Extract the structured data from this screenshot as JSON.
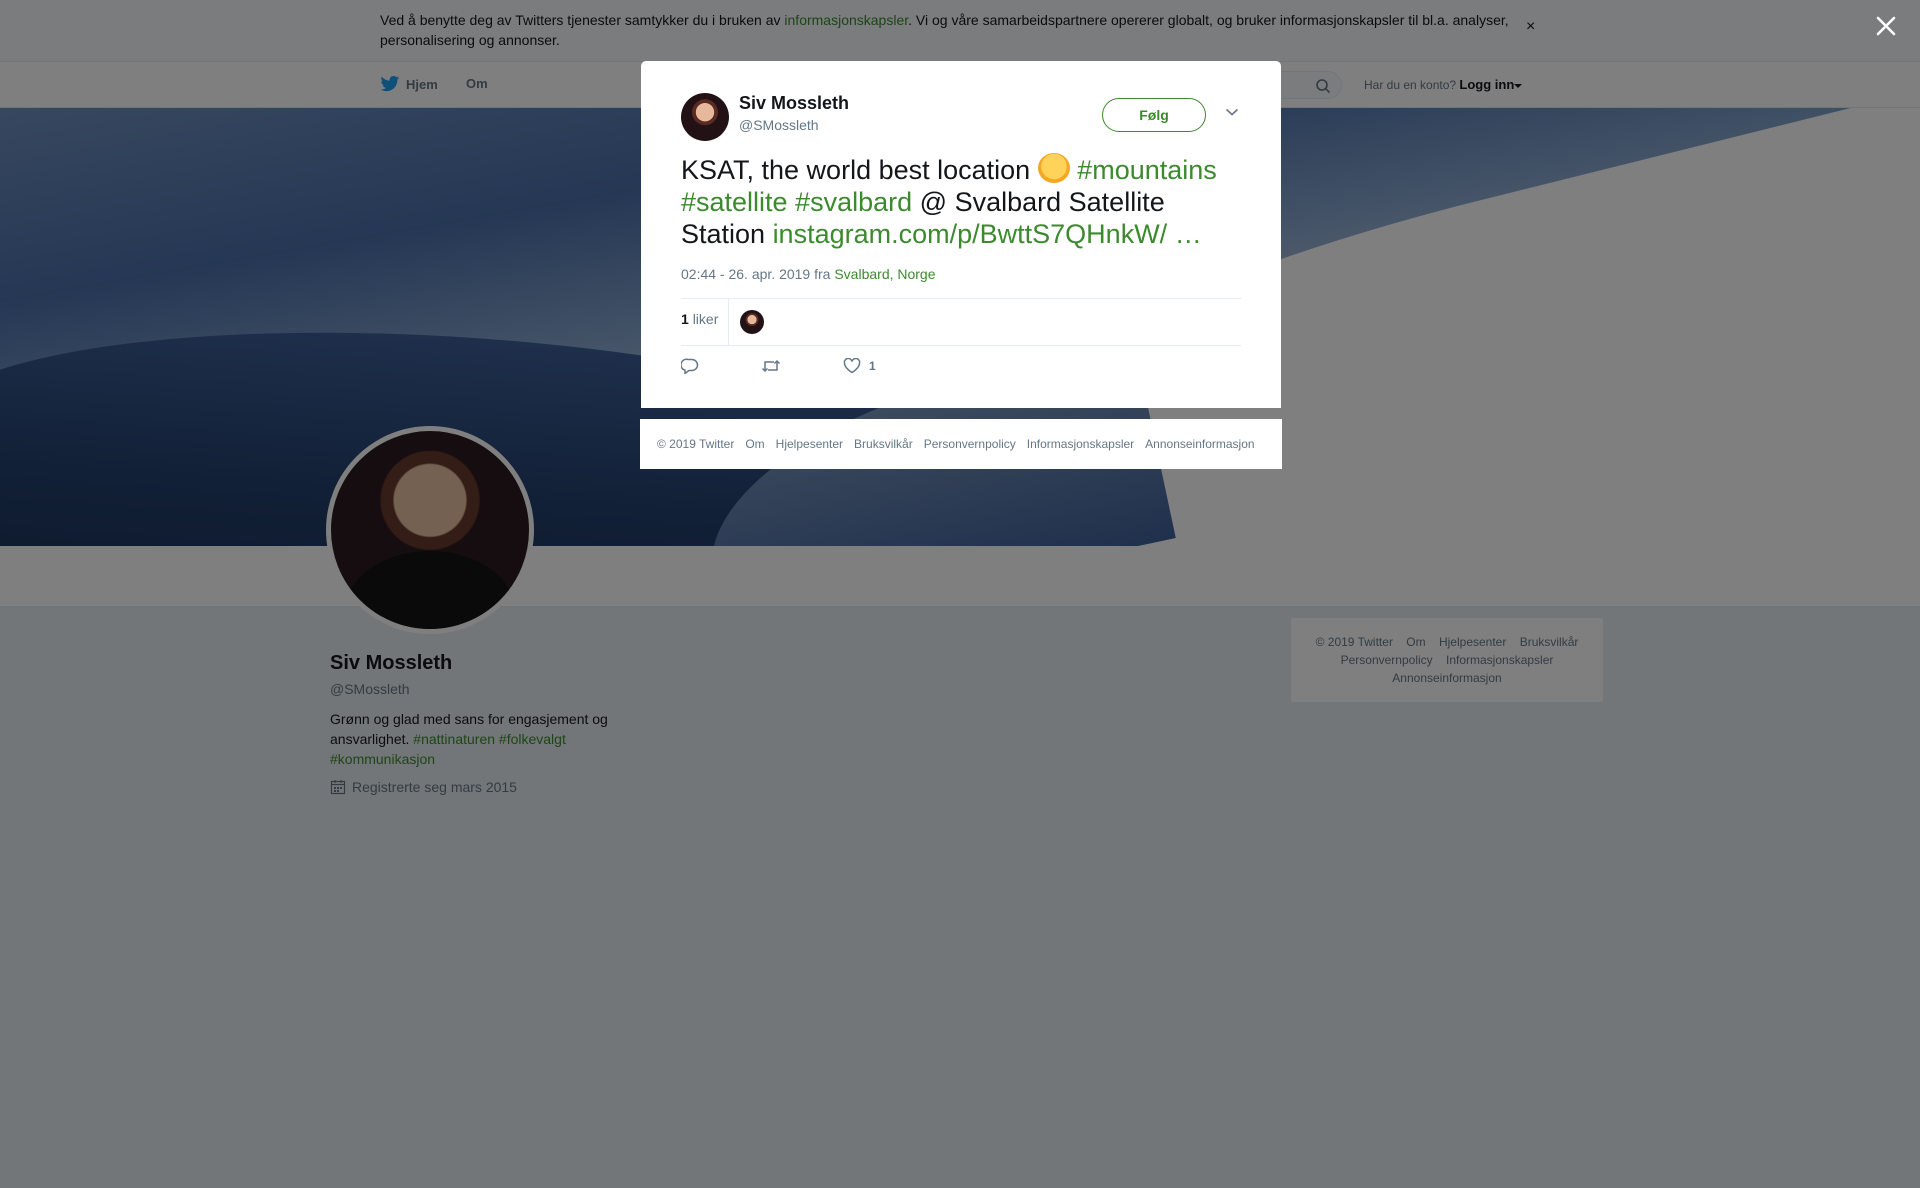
{
  "cookie_banner": {
    "text_before": "Ved å benytte deg av Twitters tjenester samtykker du i bruken av ",
    "link": "informasjonskapsler",
    "text_after": ". Vi og våre samarbeidspartnere opererer globalt, og bruker informasjonskapsler til bl.a. analyser, personalisering og annonser.",
    "close_glyph": "×"
  },
  "nav": {
    "home": "Hjem",
    "about": "Om",
    "login_prompt": "Har du en konto?",
    "login": "Logg inn"
  },
  "profile": {
    "name": "Siv Mossleth",
    "handle": "@SMossleth",
    "bio_text": "Grønn og glad med sans for engasjement og ansvarlighet.",
    "bio_hashtags": [
      "#nattinaturen",
      "#folkevalgt",
      "#kommunikasjon"
    ],
    "joined": "Registrerte seg mars 2015"
  },
  "side_footer": {
    "items": [
      "© 2019 Twitter",
      "Om",
      "Hjelpesenter",
      "Bruksvilkår",
      "Personvernpolicy",
      "Informasjonskapsler",
      "Annonseinformasjon"
    ]
  },
  "tweet": {
    "author_name": "Siv Mossleth",
    "author_handle": "@SMossleth",
    "follow_label": "Følg",
    "text_1": "KSAT, the world best location ",
    "hashtag_1": "#mountains",
    "hashtag_2": "#satellite",
    "hashtag_3": "#svalbard",
    "text_2": " @ Svalbard Satellite Station ",
    "link": "instagram.com/p/BwttS7QHnkW/",
    "ellipsis": "…",
    "timestamp": "02:44 - 26. apr. 2019 fra ",
    "location": "Svalbard, Norge",
    "likes_count": "1",
    "likes_label": "liker",
    "action_like_count": "1"
  },
  "modal_footer": {
    "items": [
      "© 2019 Twitter",
      "Om",
      "Hjelpesenter",
      "Bruksvilkår",
      "Personvernpolicy",
      "Informasjonskapsler",
      "Annonseinformasjon"
    ]
  },
  "colors": {
    "accent": "#3c8a2e",
    "muted_text": "#657786",
    "overlay": "rgba(0,0,0,0.5)"
  },
  "icons": [
    "twitter-bird-icon",
    "search-icon",
    "close-icon",
    "chevron-down-icon",
    "reply-icon",
    "retweet-icon",
    "heart-icon",
    "calendar-icon"
  ]
}
